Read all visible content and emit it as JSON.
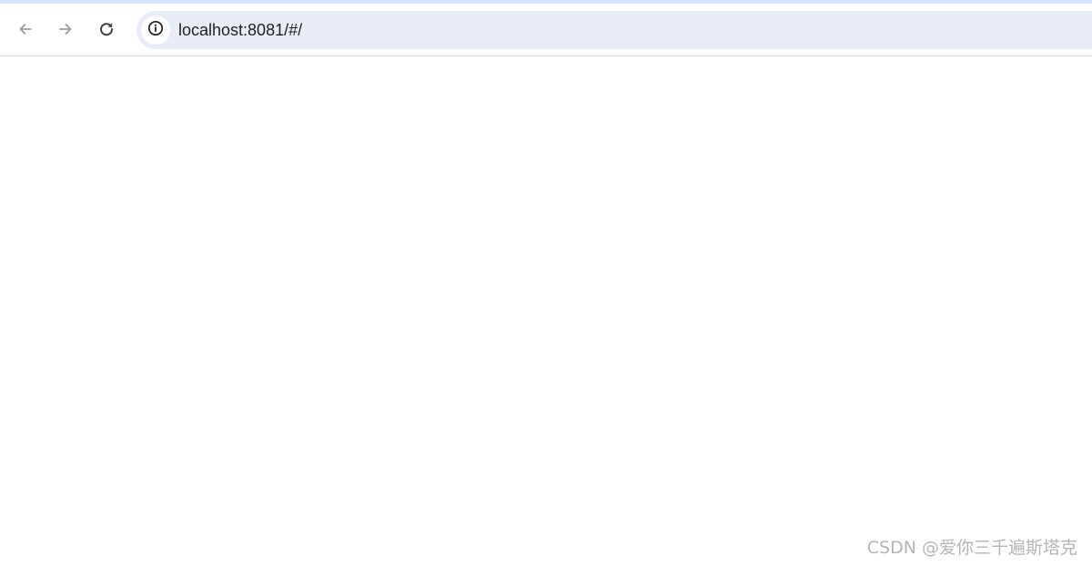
{
  "browser": {
    "toolbar": {
      "back_icon": "arrow-left-icon",
      "forward_icon": "arrow-right-icon",
      "reload_icon": "reload-icon",
      "site_info_icon": "info-circle-icon"
    },
    "omnibox": {
      "url": "localhost:8081/#/"
    }
  },
  "page": {
    "watermark": "CSDN @爱你三千遍斯塔克"
  },
  "colors": {
    "accent": "#d3e3fd",
    "omnibox_bg": "#e9edf7",
    "icon_disabled": "#9aa0a6",
    "icon_active": "#3c4043"
  }
}
